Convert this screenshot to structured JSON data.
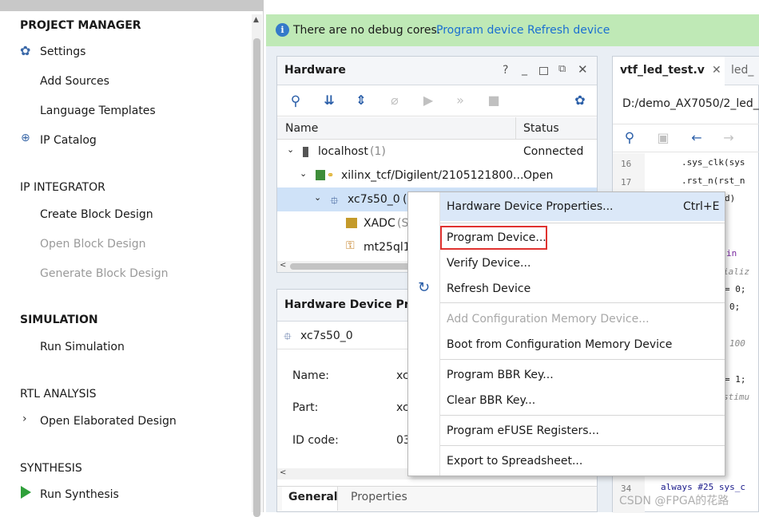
{
  "flow": {
    "project_manager": "PROJECT MANAGER",
    "settings": "Settings",
    "add_sources": "Add Sources",
    "language_templates": "Language Templates",
    "ip_catalog": "IP Catalog",
    "ip_integrator": "IP INTEGRATOR",
    "create_block_design": "Create Block Design",
    "open_block_design": "Open Block Design",
    "generate_block_design": "Generate Block Design",
    "simulation": "SIMULATION",
    "run_simulation": "Run Simulation",
    "rtl_analysis": "RTL ANALYSIS",
    "open_elaborated_design": "Open Elaborated Design",
    "synthesis": "SYNTHESIS",
    "run_synthesis": "Run Synthesis"
  },
  "info_bar": {
    "message": "There are no debug cores.",
    "program_device": "Program device",
    "refresh_device": "Refresh device"
  },
  "hardware": {
    "title": "Hardware",
    "help": "?",
    "col_name": "Name",
    "col_status": "Status",
    "rows": [
      {
        "name": "localhost",
        "count": "(1)",
        "status": "Connected"
      },
      {
        "name": "xilinx_tcf/Digilent/2105121800...",
        "status": "Open"
      },
      {
        "name": "xc7s50_0",
        "suffix": "(",
        "status": ""
      },
      {
        "name": "XADC",
        "suffix": "(S",
        "status": ""
      },
      {
        "name": "mt25ql1",
        "status": ""
      }
    ]
  },
  "device_props": {
    "title": "Hardware Device Prope",
    "device": "xc7s50_0",
    "name_label": "Name:",
    "name_value": "xc",
    "part_label": "Part:",
    "part_value": "xc",
    "id_label": "ID code:",
    "id_value": "03",
    "tab_general": "General",
    "tab_properties": "Properties"
  },
  "context_menu": {
    "items": [
      {
        "label": "Hardware Device Properties...",
        "shortcut": "Ctrl+E"
      },
      {
        "label": "Program Device..."
      },
      {
        "label": "Verify Device..."
      },
      {
        "label": "Refresh Device"
      },
      {
        "label": "Add Configuration Memory Device..."
      },
      {
        "label": "Boot from Configuration Memory Device"
      },
      {
        "label": "Program BBR Key..."
      },
      {
        "label": "Clear BBR Key..."
      },
      {
        "label": "Program eFUSE Registers..."
      },
      {
        "label": "Export to Spreadsheet..."
      }
    ]
  },
  "editor": {
    "tab1": "vtf_led_test.v",
    "tab2": "led_",
    "path": "D:/demo_AX7050/2_led_",
    "lines": [
      {
        "num": "16",
        "code": ".sys_clk(sys"
      },
      {
        "num": "17",
        "code": ".rst_n(rst_n"
      },
      {
        "num": "",
        "code": "d)"
      },
      {
        "num": "",
        "code": "in"
      },
      {
        "num": "",
        "code": "ializ"
      },
      {
        "num": "",
        "code": "= 0;"
      },
      {
        "num": "",
        "code": "0;"
      },
      {
        "num": "",
        "code": "100"
      },
      {
        "num": "",
        "code": "= 1;"
      },
      {
        "num": "",
        "code": "stimu"
      },
      {
        "num": "34",
        "code": "always #25 sys_c"
      }
    ]
  },
  "watermark": "CSDN @FPGA的花路",
  "colors": {
    "info_bg": "#bfe9b6",
    "link": "#1a6fd1",
    "selection": "#cfe2f8",
    "highlight_box": "#e0322f"
  }
}
